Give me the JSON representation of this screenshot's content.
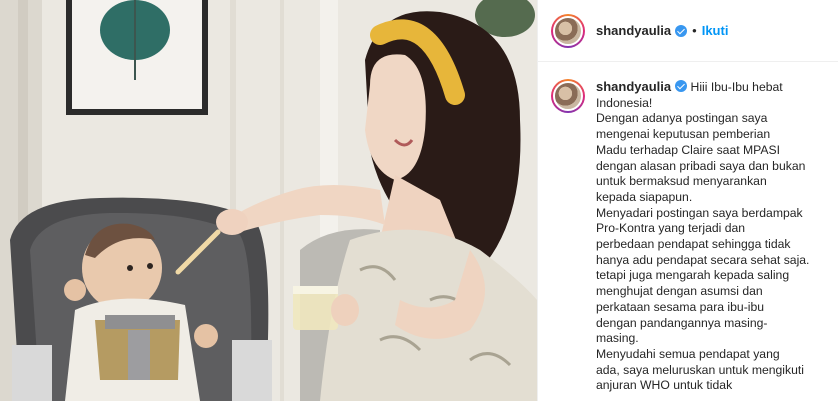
{
  "header": {
    "username": "shandyaulia",
    "separator": "•",
    "follow_label": "Ikuti"
  },
  "caption": {
    "username": "shandyaulia",
    "first_line": "Hiii Ibu-Ibu hebat",
    "lines": [
      "Indonesia!",
      "Dengan adanya postingan saya",
      "mengenai keputusan pemberian",
      "Madu terhadap Claire saat MPASI",
      "dengan alasan pribadi saya dan bukan",
      "untuk bermaksud menyarankan",
      "kepada siapapun.",
      "Menyadari postingan saya berdampak",
      "Pro-Kontra yang terjadi dan",
      "perbedaan pendapat sehingga tidak",
      "hanya adu pendapat secara sehat saja.",
      "tetapi juga mengarah kepada saling",
      "menghujat dengan asumsi dan",
      "perkataan sesama para ibu-ibu",
      "dengan pandangannya masing-",
      "masing.",
      "Menyudahi semua pendapat yang",
      "ada, saya meluruskan untuk mengikuti",
      "anjuran WHO untuk tidak"
    ]
  },
  "icons": {
    "verified": "verified-badge-icon"
  },
  "colors": {
    "link_blue": "#0095f6",
    "verified_blue": "#3897f0",
    "text": "#262626"
  }
}
